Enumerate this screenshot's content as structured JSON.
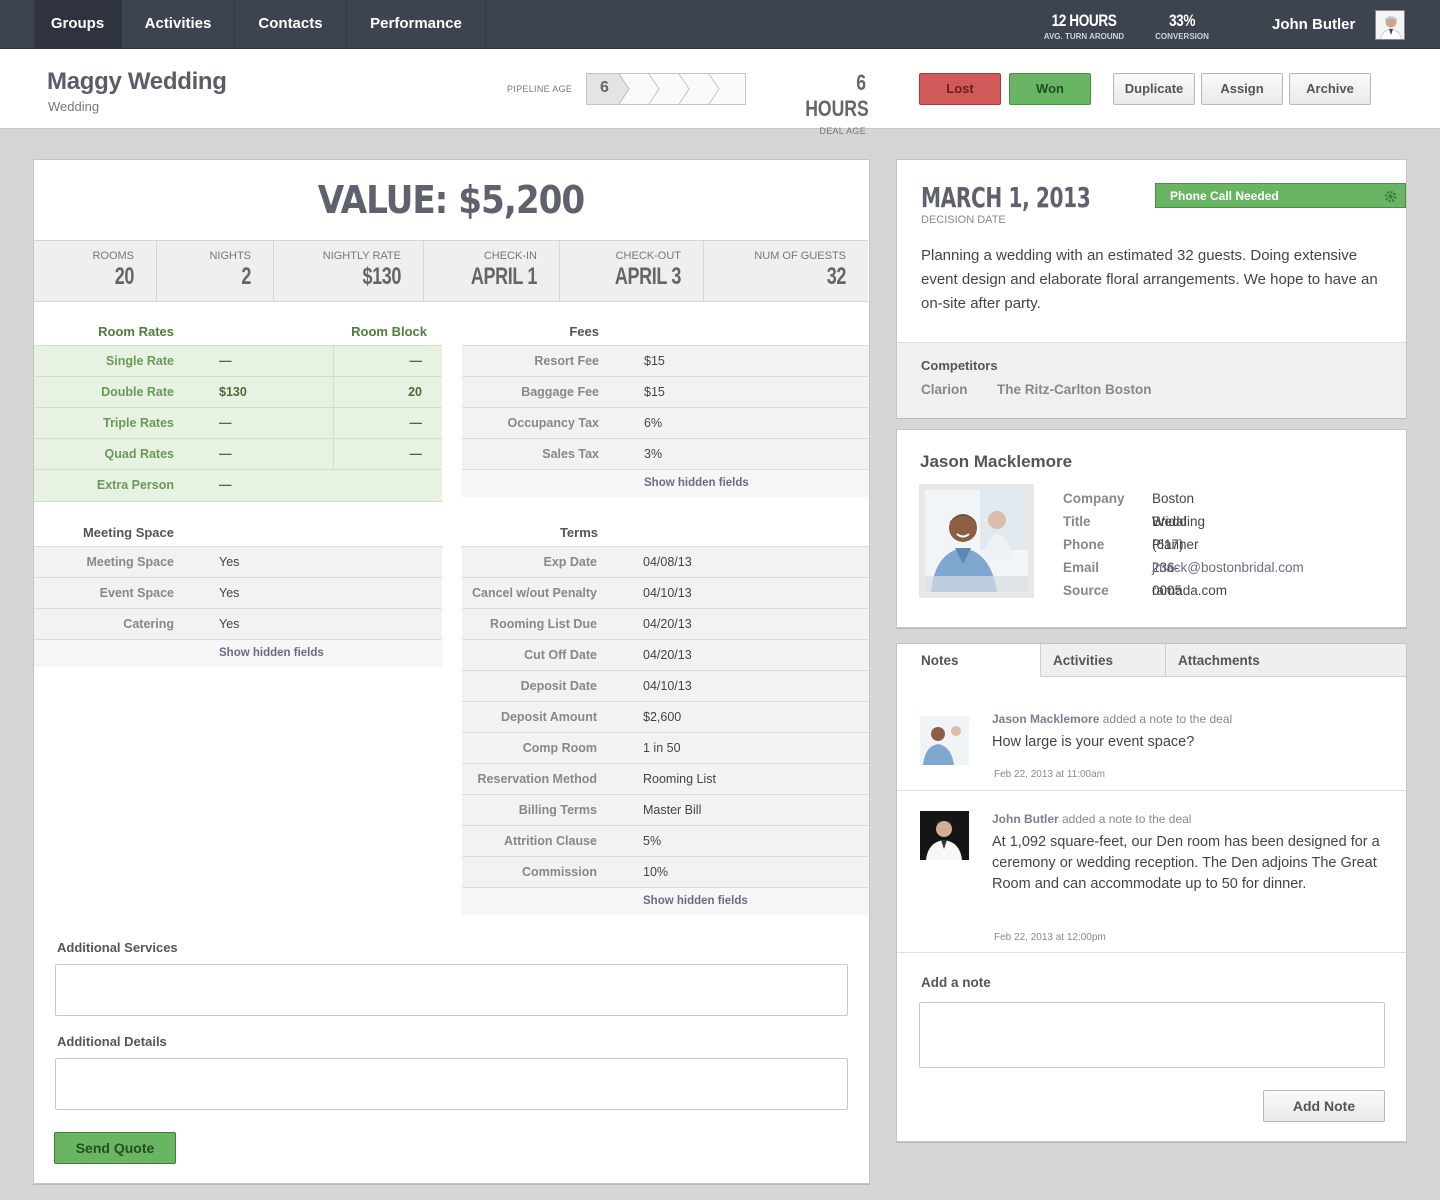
{
  "nav": {
    "tabs": [
      "Groups",
      "Activities",
      "Contacts",
      "Performance"
    ],
    "stat1_value": "12 HOURS",
    "stat1_label": "AVG. TURN AROUND",
    "stat2_value": "33%",
    "stat2_label": "CONVERSION",
    "user_name": "John Butler"
  },
  "header": {
    "title": "Maggy Wedding",
    "subtitle": "Wedding",
    "pipeline_label": "PIPELINE AGE",
    "pipeline_value": "6",
    "deal_age_value": "6 HOURS",
    "deal_age_label": "DEAL AGE",
    "buttons": {
      "lost": "Lost",
      "won": "Won",
      "duplicate": "Duplicate",
      "assign": "Assign",
      "archive": "Archive"
    }
  },
  "deal": {
    "value": "VALUE: $5,200",
    "metrics": [
      {
        "label": "ROOMS",
        "value": "20"
      },
      {
        "label": "NIGHTS",
        "value": "2"
      },
      {
        "label": "NIGHTLY RATE",
        "value": "$130"
      },
      {
        "label": "CHECK-IN",
        "value": "APRIL 1"
      },
      {
        "label": "CHECK-OUT",
        "value": "APRIL 3"
      },
      {
        "label": "NUM OF GUESTS",
        "value": "32"
      }
    ],
    "room_rates_header": "Room Rates",
    "room_block_header": "Room Block",
    "room_rates": [
      {
        "label": "Single Rate",
        "rate": "—",
        "block": "—"
      },
      {
        "label": "Double Rate",
        "rate": "$130",
        "block": "20"
      },
      {
        "label": "Triple Rates",
        "rate": "—",
        "block": "—"
      },
      {
        "label": "Quad Rates",
        "rate": "—",
        "block": "—"
      },
      {
        "label": "Extra Person",
        "rate": "—",
        "block": ""
      }
    ],
    "fees_header": "Fees",
    "fees": [
      {
        "label": "Resort Fee",
        "value": "$15"
      },
      {
        "label": "Baggage Fee",
        "value": "$15"
      },
      {
        "label": "Occupancy Tax",
        "value": "6%"
      },
      {
        "label": "Sales Tax",
        "value": "3%"
      }
    ],
    "show_hidden": "Show hidden fields",
    "meeting_header": "Meeting Space",
    "meeting": [
      {
        "label": "Meeting Space",
        "value": "Yes"
      },
      {
        "label": "Event Space",
        "value": "Yes"
      },
      {
        "label": "Catering",
        "value": "Yes"
      }
    ],
    "terms_header": "Terms",
    "terms": [
      {
        "label": "Exp Date",
        "value": "04/08/13"
      },
      {
        "label": "Cancel w/out Penalty",
        "value": "04/10/13"
      },
      {
        "label": "Rooming List Due",
        "value": "04/20/13"
      },
      {
        "label": "Cut Off Date",
        "value": "04/20/13"
      },
      {
        "label": "Deposit Date",
        "value": "04/10/13"
      },
      {
        "label": "Deposit Amount",
        "value": "$2,600"
      },
      {
        "label": "Comp Room",
        "value": "1 in 50"
      },
      {
        "label": "Reservation Method",
        "value": "Rooming List"
      },
      {
        "label": "Billing Terms",
        "value": "Master Bill"
      },
      {
        "label": "Attrition Clause",
        "value": "5%"
      },
      {
        "label": "Commission",
        "value": "10%"
      }
    ],
    "additional_services_label": "Additional Services",
    "additional_details_label": "Additional Details",
    "send_quote": "Send Quote"
  },
  "decision": {
    "date": "MARCH 1, 2013",
    "date_label": "DECISION DATE",
    "tag": "Phone Call Needed",
    "description": "Planning a wedding with an estimated 32 guests. Doing extensive event design and elaborate floral arrangements. We hope to have an on-site after party.",
    "competitors_label": "Competitors",
    "competitors": [
      "Clarion",
      "The Ritz-Carlton Boston"
    ]
  },
  "contact": {
    "name": "Jason Macklemore",
    "fields": [
      {
        "label": "Company",
        "value": "Boston Bridal"
      },
      {
        "label": "Title",
        "value": "Wedding Planner"
      },
      {
        "label": "Phone",
        "value": "(617) 236-0005"
      },
      {
        "label": "Email",
        "value": "jmack@bostonbridal.com"
      },
      {
        "label": "Source",
        "value": "ramada.com"
      }
    ]
  },
  "notes": {
    "tabs": [
      "Notes",
      "Activities",
      "Attachments"
    ],
    "items": [
      {
        "author": "Jason Macklemore",
        "action": " added a note to the deal",
        "text": "How large is your event space?",
        "date": "Feb 22, 2013 at 11:00am"
      },
      {
        "author": "John Butler",
        "action": " added a note to the deal",
        "text": "At 1,092 square-feet, our Den room has been designed for a ceremony or wedding reception. The Den adjoins The Great Room and can accommodate up to 50 for dinner.",
        "date": "Feb 22, 2013 at 12:00pm"
      }
    ],
    "add_label": "Add a note",
    "add_button": "Add Note"
  },
  "colors": {
    "nav_bg": "#3e4350",
    "won": "#6ab563",
    "lost": "#d0595a",
    "accent_green": "#4f7d3c"
  }
}
